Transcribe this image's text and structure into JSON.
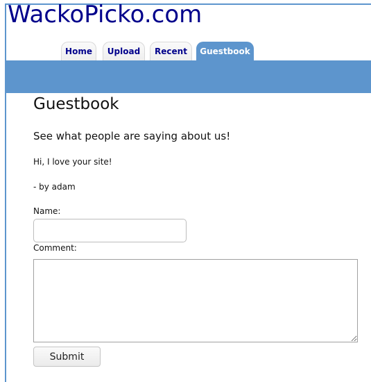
{
  "header": {
    "site_title": "WackoPicko.com"
  },
  "nav": {
    "tabs": [
      {
        "label": "Home"
      },
      {
        "label": "Upload"
      },
      {
        "label": "Recent"
      },
      {
        "label": "Guestbook",
        "active": true
      }
    ]
  },
  "main": {
    "title": "Guestbook",
    "subtitle": "See what people are saying about us!",
    "entries": [
      {
        "text": "Hi, I love your site!",
        "author": "- by adam"
      }
    ]
  },
  "form": {
    "name_label": "Name:",
    "name_value": "",
    "comment_label": "Comment:",
    "comment_value": "",
    "submit_label": "Submit"
  },
  "colors": {
    "accent": "#5d95cd",
    "title": "#00008b",
    "tab_text": "#00008b",
    "active_tab_text": "#ffffff"
  }
}
